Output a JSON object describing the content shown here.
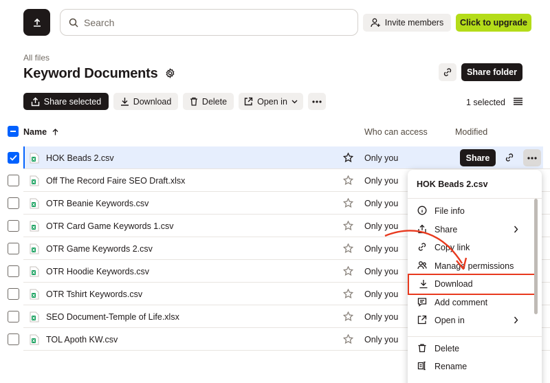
{
  "topbar": {
    "search_placeholder": "Search",
    "invite_label": "Invite members",
    "upgrade_label": "Click to upgrade",
    "upgrade_color": "#b4dc19"
  },
  "page": {
    "breadcrumb": "All files",
    "title": "Keyword Documents",
    "share_folder_label": "Share folder"
  },
  "toolbar": {
    "share_selected_label": "Share selected",
    "download_label": "Download",
    "delete_label": "Delete",
    "open_in_label": "Open in",
    "selected_count": "1 selected"
  },
  "table": {
    "columns": {
      "name": "Name",
      "access": "Who can access",
      "modified": "Modified"
    },
    "rows": [
      {
        "name": "HOK Beads 2.csv",
        "access": "Only you",
        "selected": true,
        "starred": true
      },
      {
        "name": "Off The Record Faire SEO Draft.xlsx",
        "access": "Only you"
      },
      {
        "name": "OTR Beanie Keywords.csv",
        "access": "Only you"
      },
      {
        "name": "OTR Card Game Keywords 1.csv",
        "access": "Only you"
      },
      {
        "name": "OTR Game Keywords 2.csv",
        "access": "Only you"
      },
      {
        "name": "OTR Hoodie Keywords.csv",
        "access": "Only you"
      },
      {
        "name": "OTR Tshirt Keywords.csv",
        "access": "Only you"
      },
      {
        "name": "SEO Document-Temple of Life.xlsx",
        "access": "Only you"
      },
      {
        "name": "TOL Apoth KW.csv",
        "access": "Only you"
      }
    ],
    "row_share_label": "Share",
    "accent_color": "#0061fe"
  },
  "context_menu": {
    "title": "HOK Beads 2.csv",
    "items": [
      {
        "label": "File info",
        "icon": "info-icon"
      },
      {
        "label": "Share",
        "icon": "share-icon",
        "submenu": true
      },
      {
        "label": "Copy link",
        "icon": "link-icon"
      },
      {
        "label": "Manage permissions",
        "icon": "people-icon"
      },
      {
        "label": "Download",
        "icon": "download-icon",
        "highlighted": true
      },
      {
        "label": "Add comment",
        "icon": "comment-icon"
      },
      {
        "label": "Open in",
        "icon": "open-in-icon",
        "submenu": true
      },
      {
        "label": "Delete",
        "icon": "trash-icon"
      },
      {
        "label": "Rename",
        "icon": "rename-icon"
      }
    ],
    "highlight_color": "#e8391e"
  }
}
